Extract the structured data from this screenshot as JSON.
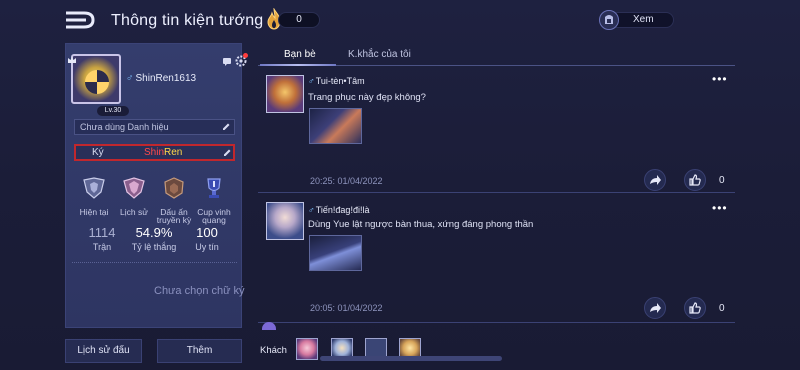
{
  "header": {
    "title": "Thông tin kiện tướng",
    "currency_value": "0",
    "view_label": "Xem"
  },
  "profile": {
    "username": "ShinRen1613",
    "gender_symbol": "♂",
    "level": "Lv.30",
    "title_placeholder": "Chưa dùng Danh hiệu",
    "signature_label": "Ký",
    "signature_name_part1": "Shin",
    "signature_name_part2": "Ren",
    "ranks": [
      {
        "label": "Hiện tại"
      },
      {
        "label": "Lịch sử"
      },
      {
        "label": "Dấu ấn truyền kỳ"
      },
      {
        "label": "Cup vinh quang"
      }
    ],
    "stats": [
      {
        "value": "1114",
        "label": "Trận"
      },
      {
        "value": "54.9%",
        "label": "Tỷ lệ thắng"
      },
      {
        "value": "100",
        "label": "Uy tín"
      }
    ],
    "no_signature": "Chưa chọn chữ ký"
  },
  "bottom_buttons": {
    "history": "Lịch sử đấu",
    "more": "Thêm"
  },
  "tabs": [
    {
      "label": "Bạn bè",
      "active": true
    },
    {
      "label": "K.khắc của tôi",
      "active": false
    }
  ],
  "posts": [
    {
      "author": "Tui-tèn•Tâm",
      "gender": "♂",
      "text": "Trang phục này đẹp không?",
      "time": "20:25: 01/04/2022",
      "likes": "0"
    },
    {
      "author": "Tiến!đag!đi!là",
      "gender": "♂",
      "text": "Dùng Yue lật ngược bàn thua, xứng đáng phong thần",
      "time": "20:05: 01/04/2022",
      "likes": "0"
    }
  ],
  "guests_label": "Khách",
  "colors": {
    "background": "#1b1d38",
    "card": "#303866",
    "signature_border": "#c1272d",
    "name_red": "#ff4a4a",
    "name_yellow": "#ffd84a"
  }
}
